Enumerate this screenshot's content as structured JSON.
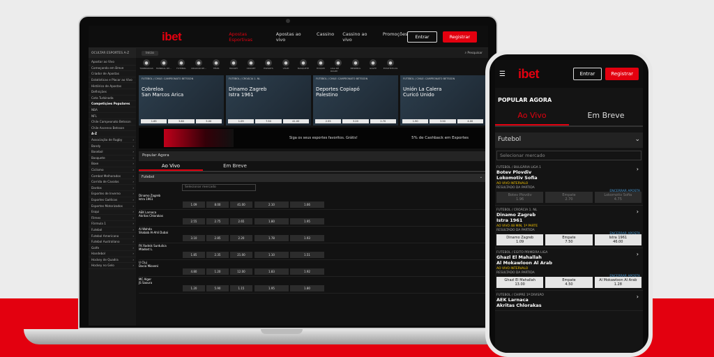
{
  "brand": {
    "logo": "ibet",
    "accent": "#e3000f"
  },
  "laptop": {
    "nav": [
      "Apostas Esportivas",
      "Apostas ao vivo",
      "Cassino",
      "Cassino ao vivo",
      "Promoções"
    ],
    "login": "Entrar",
    "register": "Registrar",
    "subbar": {
      "left": "OCULTAR ESPORTES A-Z",
      "crumb": "Início",
      "search": "Pesquisar"
    },
    "sidebar": [
      "Apostar ao Vivo",
      "Começando em Breve",
      "Criador de Apostas",
      "Estatísticas e Placar ao Vivo",
      "Histórico de Apostas",
      "Definições",
      "Cota Turbinada",
      "Competições Populares",
      "NBA",
      "NFL",
      "Chile Campeonato Betsson",
      "Chile Ascenso Betsson",
      "A-Z",
      "Associação de Rugby",
      "Bandy",
      "Basebol",
      "Basquete",
      "Boxe",
      "Ciclismo",
      "Combat Melhorados",
      "Corrida de Cavalos",
      "Dardos",
      "Esportes de Inverno",
      "Esportes Gaélicos",
      "Esportes Motorizados",
      "Esqui",
      "Filmes",
      "Fórmula 1",
      "Futebol",
      "Futebol Americano",
      "Futebol Australiano",
      "Golfe",
      "Handebol",
      "Hockey de Quadra",
      "Hockey no Gelo"
    ],
    "sports": [
      "TURBINADAS",
      "MUNDIAL DE...",
      "FUTEBOL",
      "CRIADOR DE...",
      "TÊNIS",
      "HOCKEY",
      "CRICKET",
      "ESPORTS",
      "VÔLEI",
      "BASQUETE",
      "HÓQUEI",
      "LIGA DE RUGBY",
      "BEISEBOL",
      "GOLFE",
      "ESTATÍSTICAS"
    ],
    "featured": [
      {
        "league": "FUTEBOL / CHILE: CAMPEONATO BETSSON",
        "home": "Cobreloa",
        "away": "San Marcos Arica",
        "o1": "1.65",
        "ox": "3.60",
        "o2": "5.00",
        "more": "+27"
      },
      {
        "league": "FUTEBOL / CROÁCIA 1. NL",
        "home": "Dinamo Zagreb",
        "away": "Istra 1961",
        "o1": "1.09",
        "ox": "7.50",
        "o2": "41.00",
        "more": "+27"
      },
      {
        "league": "FUTEBOL / CHILE: CAMPEONATO BETSSON",
        "home": "Deportes Copiapó",
        "away": "Palestino",
        "o1": "2.55",
        "ox": "3.20",
        "o2": "2.70",
        "more": "+27"
      },
      {
        "league": "FUTEBOL / CHILE: CAMPEONATO BETSSON",
        "home": "Unión La Calera",
        "away": "Curicó Unido",
        "o1": "1.90",
        "ox": "3.50",
        "o2": "4.00",
        "more": "+27"
      }
    ],
    "banner": {
      "t1": "Siga os seus esportes favoritos. Grátis!",
      "t2": "5% de Cashback em Esportes"
    },
    "popular": "Popular Agora",
    "tabs": [
      "Ao Vivo",
      "Em Breve"
    ],
    "section": "Futebol",
    "select": "Selecionar mercado",
    "matches": [
      {
        "home": "Dinamo Zagreb",
        "away": "Istra 1961",
        "o": [
          "1.09",
          "8.00",
          "41.00"
        ],
        "g": [
          "2.10",
          "1.66"
        ]
      },
      {
        "home": "AEK Larnaca",
        "away": "Akritas Chlorakas",
        "o": [
          "2.55",
          "2.75",
          "2.65"
        ],
        "g": [
          "1.80",
          "1.95"
        ]
      },
      {
        "home": "Al Wahda",
        "away": "Shabab Al-Ahli Dubai",
        "o": [
          "3.10",
          "2.85",
          "2.20"
        ],
        "g": [
          "1.78",
          "1.93"
        ]
      },
      {
        "home": "FK Radnik Surdulica",
        "away": "Mladost L.",
        "o": [
          "1.85",
          "2.35",
          "21.00"
        ],
        "g": [
          "1.10",
          "1.51"
        ]
      },
      {
        "home": "U Cluj",
        "away": "Dacia Mioveni",
        "o": [
          "4.80",
          "1.20",
          "12.00"
        ],
        "g": [
          "1.83",
          "1.92"
        ]
      },
      {
        "home": "MC Alger",
        "away": "JS Saoura",
        "o": [
          "1.20",
          "5.90",
          "1.15"
        ],
        "g": [
          "1.95",
          "1.80"
        ]
      }
    ]
  },
  "phone": {
    "login": "Entrar",
    "register": "Registrar",
    "title": "POPULAR AGORA",
    "tabs": [
      "Ao Vivo",
      "Em Breve"
    ],
    "section": "Futebol",
    "select": "Selecionar mercado",
    "matches": [
      {
        "league": "FUTEBOL / BULGÁRIA LIGA 1",
        "home": "Botev Plovdiv",
        "away": "Lokomotiv Sofia",
        "sh": "0",
        "sa": "0",
        "more": "+16",
        "live": "AO VIVO INTERVALO",
        "res": "RESULTADO DA PARTIDA",
        "enc": "ENCERRAR APOSTA",
        "odds": [
          "Botev Plovdiv",
          "1.96",
          "Empate",
          "2.70",
          "Lokomotiv Sofia",
          "4.75"
        ],
        "dark": true
      },
      {
        "league": "FUTEBOL / CROÁCIA 1. NL",
        "home": "Dinamo Zagreb",
        "away": "Istra 1961",
        "sh": "1",
        "sa": "0",
        "more": "+28",
        "live": "AO VIVO 48 MIN, 1º PARTE",
        "res": "RESULTADO DA PARTIDA",
        "enc": "ENCERRAR APOSTA",
        "odds": [
          "Dinamo Zagreb",
          "1.09",
          "Empate",
          "7.50",
          "Istra 1961",
          "46.00"
        ],
        "dark": false
      },
      {
        "league": "FUTEBOL / EGITO PRIMEIRA LIGA",
        "home": "Ghazl El Mahallah",
        "away": "Al Mokawloon Al Arab",
        "sh": "0",
        "sa": "1",
        "more": "+17",
        "live": "AO VIVO INTERVALO",
        "res": "RESULTADO DA PARTIDA",
        "enc": "ENCERRAR APOSTA",
        "odds": [
          "Ghazl El Mahallah",
          "13.00",
          "Empate",
          "4.50",
          "Al Mokawloon Al Arab",
          "1.28"
        ],
        "dark": false
      },
      {
        "league": "FUTEBOL / CHIPRE 1ª DIVISÃO",
        "home": "AEK Larnaca",
        "away": "Akritas Chlorakas",
        "sh": "0",
        "sa": "0",
        "more": "",
        "live": "",
        "res": "",
        "enc": "",
        "odds": [],
        "dark": false
      }
    ]
  }
}
